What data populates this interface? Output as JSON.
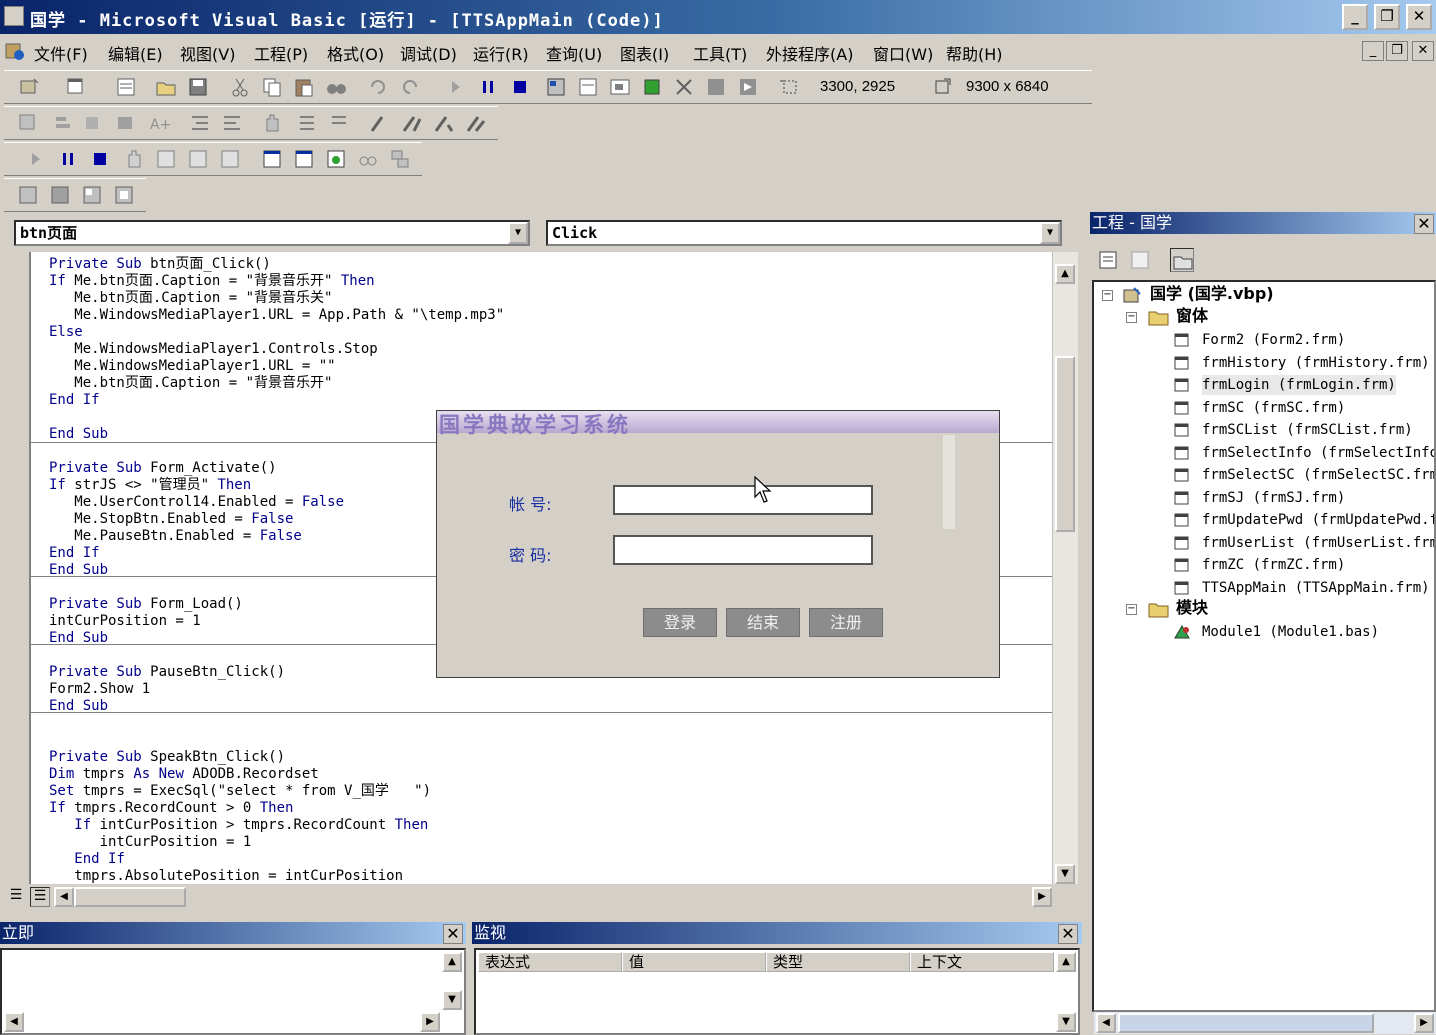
{
  "window": {
    "title": "国学 - Microsoft Visual Basic [运行] - [TTSAppMain (Code)]",
    "minimize": "_",
    "restore": "❐",
    "close": "✕"
  },
  "menu": {
    "items": [
      "文件(F)",
      "编辑(E)",
      "视图(V)",
      "工程(P)",
      "格式(O)",
      "调试(D)",
      "运行(R)",
      "查询(U)",
      "图表(I)",
      "工具(T)",
      "外接程序(A)",
      "窗口(W)",
      "帮助(H)"
    ],
    "mdi_min": "_",
    "mdi_restore": "❐",
    "mdi_close": "✕"
  },
  "toolbar": {
    "position": "3300, 2925",
    "size": "9300 x 6840"
  },
  "code": {
    "object_combo": "btn页面",
    "proc_combo": "Click",
    "lines": [
      "Private Sub btn页面_Click()",
      "If Me.btn页面.Caption = \"背景音乐开\" Then",
      "   Me.btn页面.Caption = \"背景音乐关\"",
      "   Me.WindowsMediaPlayer1.URL = App.Path & \"\\temp.mp3\"",
      "Else",
      "   Me.WindowsMediaPlayer1.Controls.Stop",
      "   Me.WindowsMediaPlayer1.URL = \"\"",
      "   Me.btn页面.Caption = \"背景音乐开\"",
      "End If",
      "",
      "End Sub",
      "",
      "Private Sub Form_Activate()",
      "If strJS <> \"管理员\" Then",
      "   Me.UserControl14.Enabled = False",
      "   Me.StopBtn.Enabled = False",
      "   Me.PauseBtn.Enabled = False",
      "End If",
      "End Sub",
      "",
      "Private Sub Form_Load()",
      "intCurPosition = 1",
      "End Sub",
      "",
      "Private Sub PauseBtn_Click()",
      "Form2.Show 1",
      "End Sub",
      "",
      "",
      "Private Sub SpeakBtn_Click()",
      "Dim tmprs As New ADODB.Recordset",
      "Set tmprs = ExecSql(\"select * from V_国学   \")",
      "If tmprs.RecordCount > 0 Then",
      "   If intCurPosition > tmprs.RecordCount Then",
      "      intCurPosition = 1",
      "   End If",
      "   tmprs.AbsolutePosition = intCurPosition"
    ]
  },
  "login": {
    "title": "国学典故学习系统",
    "account_label": "帐    号:",
    "password_label": "密    码:",
    "account_value": "",
    "password_value": "",
    "login_btn": "登录",
    "end_btn": "结束",
    "register_btn": "注册"
  },
  "project": {
    "title": "工程 - 国学",
    "root": "国学 (国学.vbp)",
    "forms_folder": "窗体",
    "forms": [
      "Form2 (Form2.frm)",
      "frmHistory (frmHistory.frm)",
      "frmLogin (frmLogin.frm)",
      "frmSC (frmSC.frm)",
      "frmSCList (frmSCList.frm)",
      "frmSelectInfo (frmSelectInfo",
      "frmSelectSC (frmSelectSC.frm",
      "frmSJ (frmSJ.frm)",
      "frmUpdatePwd (frmUpdatePwd.f",
      "frmUserList (frmUserList.frm",
      "frmZC (frmZC.frm)",
      "TTSAppMain (TTSAppMain.frm)"
    ],
    "modules_folder": "模块",
    "modules": [
      "Module1 (Module1.bas)"
    ]
  },
  "immediate": {
    "title": "立即"
  },
  "watch": {
    "title": "监视",
    "columns": [
      "表达式",
      "值",
      "类型",
      "上下文"
    ]
  }
}
